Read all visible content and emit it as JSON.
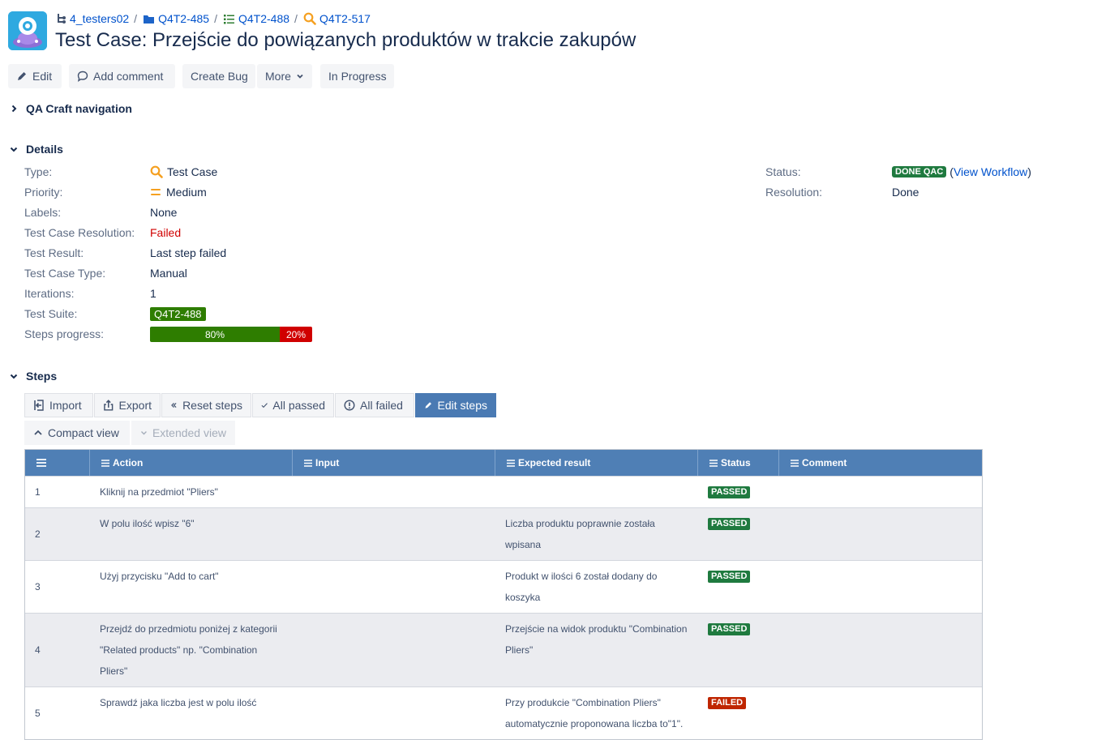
{
  "header": {
    "breadcrumbs": [
      {
        "label": "4_testers02",
        "icon": "project-tree-icon"
      },
      {
        "label": "Q4T2-485",
        "icon": "folder-icon"
      },
      {
        "label": "Q4T2-488",
        "icon": "list-icon"
      },
      {
        "label": "Q4T2-517",
        "icon": "search-icon"
      }
    ],
    "title": "Test Case:  Przejście do powiązanych produktów w trakcie zakupów"
  },
  "toolbar": {
    "edit": "Edit",
    "add_comment": "Add comment",
    "create_bug": "Create Bug",
    "more": "More",
    "in_progress": "In Progress"
  },
  "sections": {
    "qa_nav": "QA Craft navigation",
    "details": "Details",
    "steps": "Steps"
  },
  "details": {
    "type_label": "Type:",
    "type_value": "Test Case",
    "priority_label": "Priority:",
    "priority_value": "Medium",
    "labels_label": "Labels:",
    "labels_value": "None",
    "tcr_label": "Test Case Resolution:",
    "tcr_value": "Failed",
    "result_label": "Test Result:",
    "result_value": "Last step failed",
    "tctype_label": "Test Case Type:",
    "tctype_value": "Manual",
    "iter_label": "Iterations:",
    "iter_value": "1",
    "suite_label": "Test Suite:",
    "suite_value": "Q4T2-488",
    "progress_label": "Steps progress:",
    "progress_passed": 0.8,
    "progress_passed_text": "80%",
    "progress_failed": 0.2,
    "progress_failed_text": "20%",
    "status_label": "Status:",
    "status_value": "DONE QAC",
    "workflow_link": "View Workflow",
    "resolution_label": "Resolution:",
    "resolution_value": "Done"
  },
  "steps_toolbar": {
    "import": "Import",
    "export": "Export",
    "reset": "Reset steps",
    "all_passed": "All passed",
    "all_failed": "All failed",
    "edit_steps": "Edit steps",
    "compact": "Compact view",
    "extended": "Extended view"
  },
  "table": {
    "headers": {
      "action": "Action",
      "input": "Input",
      "expected": "Expected result",
      "status": "Status",
      "comment": "Comment"
    },
    "rows": [
      {
        "num": "1",
        "action": "Kliknij na przedmiot \"Pliers\"",
        "input": "",
        "expected": "",
        "status": "PASSED",
        "comment": ""
      },
      {
        "num": "2",
        "action": "W polu ilość wpisz \"6\"",
        "input": "",
        "expected": "Liczba produktu poprawnie została wpisana",
        "status": "PASSED",
        "comment": ""
      },
      {
        "num": "3",
        "action": "Użyj przycisku \"Add to cart\"",
        "input": "",
        "expected": "Produkt w ilości 6 został dodany do koszyka",
        "status": "PASSED",
        "comment": ""
      },
      {
        "num": "4",
        "action": "Przejdź do przedmiotu poniżej z kategorii \"Related products\" np. \"Combination Pliers\"",
        "input": "",
        "expected": "Przejście na widok produktu \"Combination Pliers\"",
        "status": "PASSED",
        "comment": ""
      },
      {
        "num": "5",
        "action": "Sprawdź jaka liczba jest w polu ilość",
        "input": "",
        "expected": "Przy produkcie \"Combination Pliers\" automatycznie proponowana liczba to\"1\".",
        "status": "FAILED",
        "comment": ""
      }
    ]
  },
  "colors": {
    "passed": "#1f7a3f",
    "failed": "#bf2600",
    "accent": "#4f7fb5",
    "link": "#0052cc"
  }
}
